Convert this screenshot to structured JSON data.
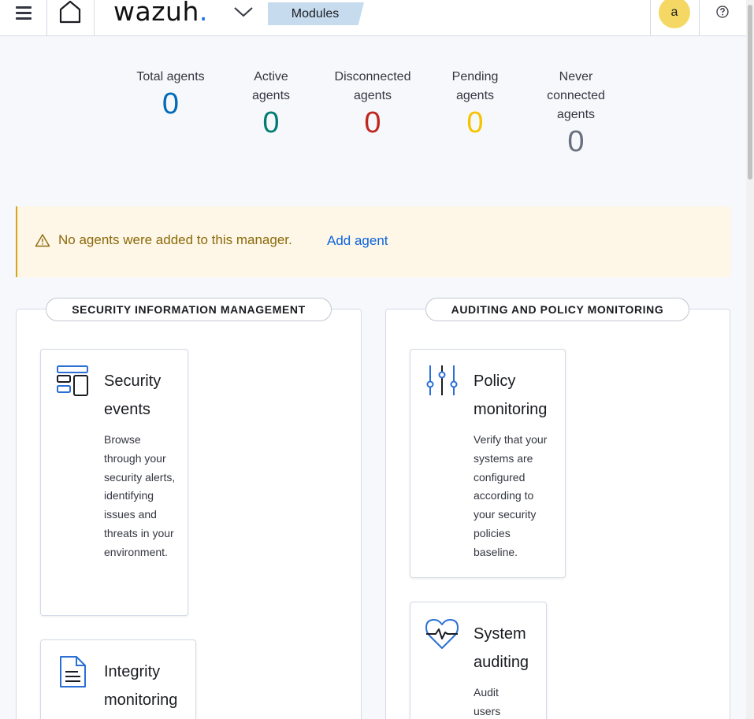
{
  "header": {
    "menu_icon": "hamburger-icon",
    "home_icon": "home-icon",
    "logo_text": "wazuh",
    "logo_dot": ".",
    "logo_accent": "#1a6de0",
    "dropdown_icon": "chevron-down-icon",
    "breadcrumb": "Modules",
    "avatar_letter": "a",
    "help_icon": "question-icon"
  },
  "stats": [
    {
      "label": "Total agents",
      "value": "0",
      "color": "#006bb8"
    },
    {
      "label": "Active agents",
      "value": "0",
      "color": "#017d73"
    },
    {
      "label": "Disconnected agents",
      "value": "0",
      "color": "#bd271e"
    },
    {
      "label": "Pending agents",
      "value": "0",
      "color": "#f5c400"
    },
    {
      "label": "Never connected agents",
      "value": "0",
      "color": "#69707d"
    }
  ],
  "callout": {
    "icon": "warning-icon",
    "message": "No agents were added to this manager.",
    "link": "Add agent"
  },
  "sections": [
    {
      "title": "SECURITY INFORMATION MANAGEMENT",
      "cards": [
        {
          "icon": "dashboard-layout-icon",
          "title": "Security events",
          "description": "Browse through your security alerts, identifying issues and threats in your environment."
        },
        {
          "icon": "document-icon",
          "title": "Integrity monitoring",
          "description": ""
        }
      ]
    },
    {
      "title": "AUDITING AND POLICY MONITORING",
      "cards": [
        {
          "icon": "sliders-icon",
          "title": "Policy monitoring",
          "description": "Verify that your systems are configured according to your security policies baseline."
        },
        {
          "icon": "heartbeat-icon",
          "title": "System auditing",
          "description": "Audit users"
        }
      ]
    }
  ]
}
